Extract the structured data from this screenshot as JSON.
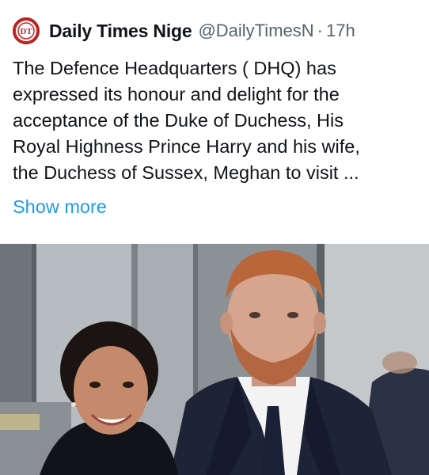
{
  "tweet": {
    "author_name": "Daily Times Nige",
    "handle": "@DailyTimesN",
    "separator": "·",
    "time": "17h",
    "avatar_icon": "daily-times-logo-icon",
    "avatar_text": "DT",
    "text": "The Defence Headquarters ( DHQ) has\nexpressed its honour and delight for the\nacceptance of the Duke of Duchess, His\nRoyal Highness Prince Harry and his wife,\nthe Duchess of Sussex, Meghan to visit ...",
    "show_more": "Show more"
  },
  "colors": {
    "link": "#1d9bf0",
    "secondary_text": "#536471",
    "avatar_red": "#c62828"
  }
}
